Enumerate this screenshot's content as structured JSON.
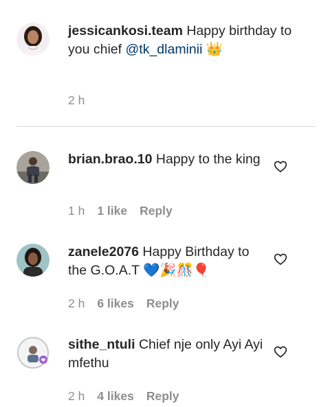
{
  "caption": {
    "username": "jessicankosi.team",
    "text": "Happy birthday to you chief",
    "mention": "@tk_dlaminii",
    "emoji": "👑",
    "time": "2 h"
  },
  "comments": [
    {
      "username": "brian.brao.10",
      "text": "Happy to the king",
      "time": "1 h",
      "likes": "1 like",
      "reply": "Reply",
      "like_icon": "heart-outline"
    },
    {
      "username": "zanele2076",
      "text": "Happy Birthday to the G.O.A.T 💙🎉🎊🎈",
      "time": "2 h",
      "likes": "6 likes",
      "reply": "Reply",
      "like_icon": "heart-outline"
    },
    {
      "username": "sithe_ntuli",
      "text": "Chief nje only Ayi Ayi mfethu",
      "time": "2 h",
      "likes": "4 likes",
      "reply": "Reply",
      "like_icon": "heart-outline"
    }
  ],
  "colors": {
    "text": "#262626",
    "secondary": "#8e8e8e",
    "mention": "#00376b",
    "divider": "#dbdbdb"
  }
}
